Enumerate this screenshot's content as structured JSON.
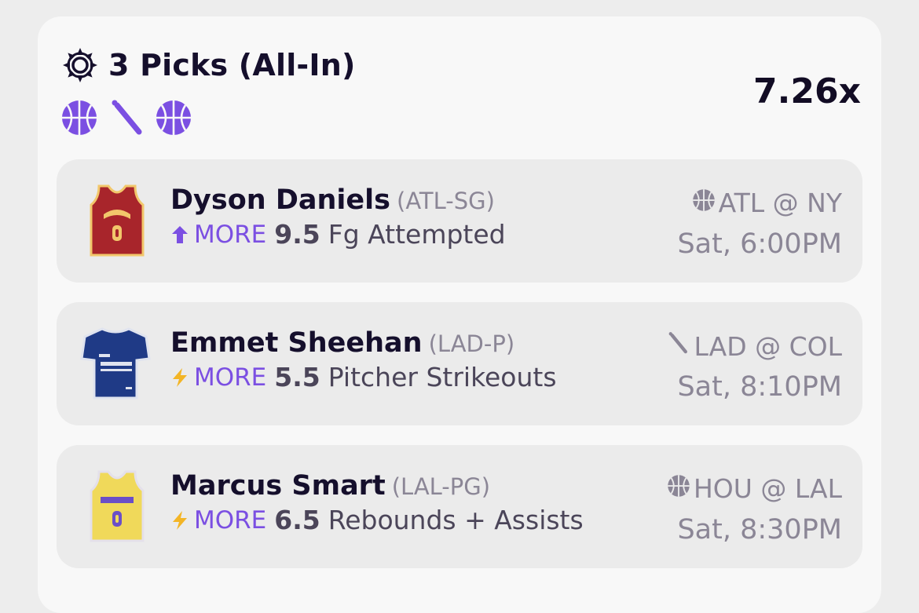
{
  "entry": {
    "title": "3 Picks (All-In)",
    "multiplier": "7.26x",
    "sport_icons": [
      "basketball-icon",
      "baseball-bat-icon",
      "basketball-icon"
    ]
  },
  "picks": [
    {
      "player": "Dyson Daniels",
      "position": "(ATL-SG)",
      "direction": "MORE",
      "direction_icon": "arrow-up-icon",
      "line": "9.5",
      "stat": "Fg Attempted",
      "sport_icon": "basketball-icon",
      "matchup": "ATL @ NY",
      "time": "Sat, 6:00PM",
      "jersey_icon": "basketball-jersey-icon",
      "jersey_color": "#a8252b"
    },
    {
      "player": "Emmet Sheehan",
      "position": "(LAD-P)",
      "direction": "MORE",
      "direction_icon": "lightning-icon",
      "line": "5.5",
      "stat": "Pitcher Strikeouts",
      "sport_icon": "baseball-bat-icon",
      "matchup": "LAD @ COL",
      "time": "Sat, 8:10PM",
      "jersey_icon": "baseball-jersey-icon",
      "jersey_color": "#1f3a86"
    },
    {
      "player": "Marcus Smart",
      "position": "(LAL-PG)",
      "direction": "MORE",
      "direction_icon": "lightning-icon",
      "line": "6.5",
      "stat": "Rebounds + Assists",
      "sport_icon": "basketball-icon",
      "matchup": "HOU @ LAL",
      "time": "Sat, 8:30PM",
      "jersey_icon": "basketball-jersey-icon",
      "jersey_color": "#f0d95a"
    }
  ],
  "colors": {
    "accent": "#7b4fe2",
    "lightning": "#f3b526",
    "muted_text": "#8b8696",
    "card_bg": "#f8f8f8",
    "pick_bg": "#ebebeb"
  }
}
